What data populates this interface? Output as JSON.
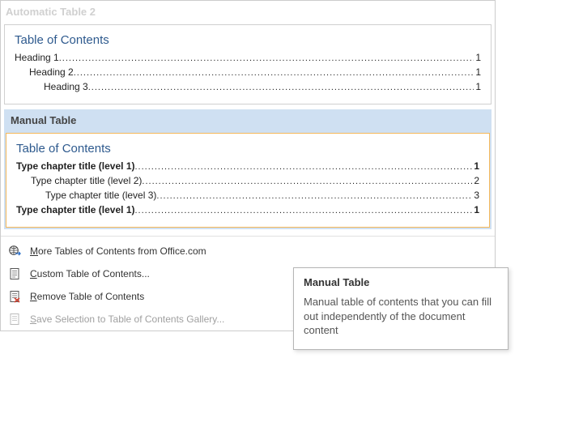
{
  "gallery": {
    "auto2": {
      "title": "Automatic Table 2",
      "heading": "Table of Contents",
      "lines": [
        {
          "label": "Heading 1",
          "page": "1",
          "indent": 0,
          "bold": false
        },
        {
          "label": "Heading 2",
          "page": "1",
          "indent": 1,
          "bold": false
        },
        {
          "label": "Heading 3",
          "page": "1",
          "indent": 2,
          "bold": false
        }
      ]
    },
    "manual": {
      "title": "Manual Table",
      "heading": "Table of Contents",
      "lines": [
        {
          "label": "Type chapter title (level 1)",
          "page": "1",
          "indent": 0,
          "bold": true
        },
        {
          "label": "Type chapter title (level 2)",
          "page": "2",
          "indent": 1,
          "bold": false
        },
        {
          "label": "Type chapter title (level 3)",
          "page": "3",
          "indent": 2,
          "bold": false
        },
        {
          "label": "Type chapter title (level 1)",
          "page": "1",
          "indent": 0,
          "bold": true
        }
      ]
    }
  },
  "menu": {
    "more": "More Tables of Contents from Office.com",
    "custom": "Custom Table of Contents...",
    "remove": "Remove Table of Contents",
    "save": "Save Selection to Table of Contents Gallery..."
  },
  "tooltip": {
    "title": "Manual Table",
    "desc": "Manual table of contents that you can fill out independently of the document content"
  }
}
